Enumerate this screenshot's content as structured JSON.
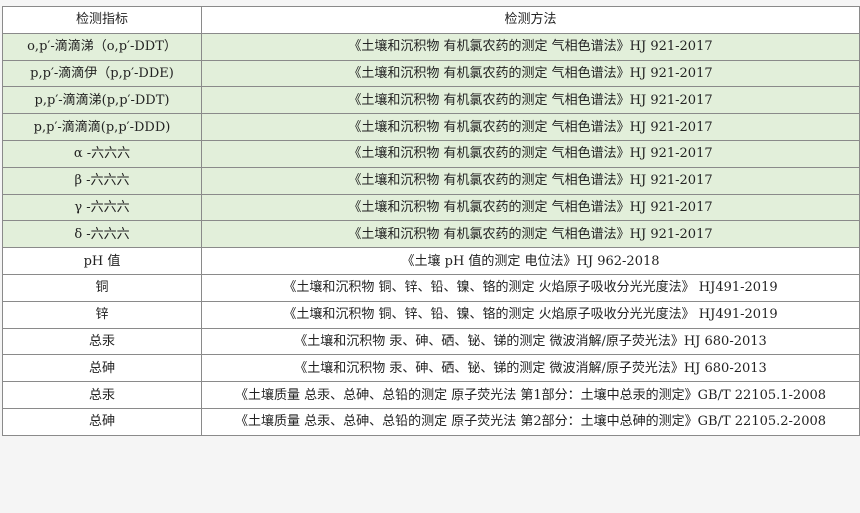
{
  "table": {
    "headers": [
      "检测指标",
      "检测方法"
    ],
    "rows": [
      {
        "indicator": "o,p′-滴滴涕（o,p′-DDT）",
        "method": "《土壤和沉积物 有机氯农药的测定 气相色谱法》HJ 921-2017",
        "highlight": true
      },
      {
        "indicator": "p,p′-滴滴伊（p,p′-DDE)",
        "method": "《土壤和沉积物 有机氯农药的测定 气相色谱法》HJ 921-2017",
        "highlight": true
      },
      {
        "indicator": "p,p′-滴滴涕(p,p′-DDT)",
        "method": "《土壤和沉积物 有机氯农药的测定 气相色谱法》HJ 921-2017",
        "highlight": true
      },
      {
        "indicator": "p,p′-滴滴滴(p,p′-DDD)",
        "method": "《土壤和沉积物 有机氯农药的测定 气相色谱法》HJ 921-2017",
        "highlight": true
      },
      {
        "indicator": "α -六六六",
        "method": "《土壤和沉积物 有机氯农药的测定 气相色谱法》HJ 921-2017",
        "highlight": true
      },
      {
        "indicator": "β -六六六",
        "method": "《土壤和沉积物 有机氯农药的测定 气相色谱法》HJ 921-2017",
        "highlight": true
      },
      {
        "indicator": "γ -六六六",
        "method": "《土壤和沉积物 有机氯农药的测定 气相色谱法》HJ 921-2017",
        "highlight": true
      },
      {
        "indicator": "δ -六六六",
        "method": "《土壤和沉积物 有机氯农药的测定 气相色谱法》HJ 921-2017",
        "highlight": true
      },
      {
        "indicator": "pH 值",
        "method": "《土壤 pH 值的测定 电位法》HJ 962-2018",
        "highlight": false
      },
      {
        "indicator": "铜",
        "method": "《土壤和沉积物 铜、锌、铅、镍、铬的测定 火焰原子吸收分光光度法》 HJ491-2019",
        "highlight": false
      },
      {
        "indicator": "锌",
        "method": "《土壤和沉积物 铜、锌、铅、镍、铬的测定 火焰原子吸收分光光度法》 HJ491-2019",
        "highlight": false
      },
      {
        "indicator": "总汞",
        "method": "《土壤和沉积物 汞、砷、硒、铋、锑的测定 微波消解/原子荧光法》HJ 680-2013",
        "highlight": false
      },
      {
        "indicator": "总砷",
        "method": "《土壤和沉积物 汞、砷、硒、铋、锑的测定 微波消解/原子荧光法》HJ 680-2013",
        "highlight": false
      },
      {
        "indicator": "总汞",
        "method": "《土壤质量 总汞、总砷、总铅的测定 原子荧光法 第1部分：土壤中总汞的测定》GB/T 22105.1-2008",
        "highlight": false
      },
      {
        "indicator": "总砷",
        "method": "《土壤质量 总汞、总砷、总铅的测定 原子荧光法 第2部分：土壤中总砷的测定》GB/T 22105.2-2008",
        "highlight": false
      }
    ]
  },
  "colors": {
    "highlight_row": "#e2efda",
    "normal_row": "#ffffff",
    "border": "#8a8a8a",
    "page_background": "#f5f5f5"
  }
}
